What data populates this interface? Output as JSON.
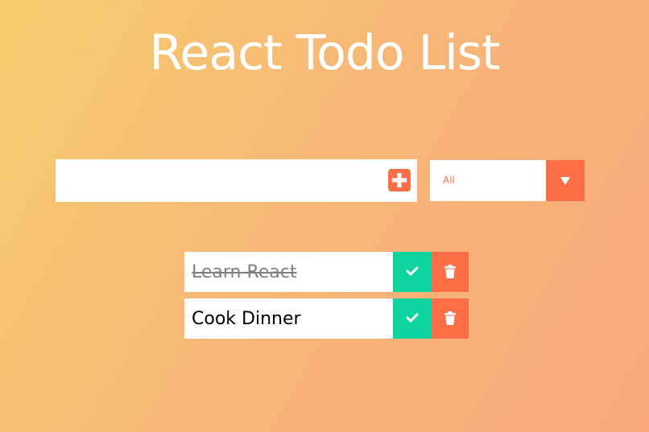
{
  "app": {
    "title": "React Todo List"
  },
  "input": {
    "value": "",
    "placeholder": "",
    "add_icon": "plus-square-icon"
  },
  "filter": {
    "selected": "All",
    "arrow_icon": "caret-down-icon"
  },
  "todos": [
    {
      "text": "Learn React",
      "completed": true
    },
    {
      "text": "Cook Dinner",
      "completed": false
    }
  ],
  "colors": {
    "accent": "#ff6f47",
    "complete": "#0ed4a0",
    "text_completed": "#808080",
    "background_start": "#f6cd6d",
    "background_end": "#f9a97b"
  },
  "icons": {
    "complete": "check-icon",
    "delete": "trash-icon"
  }
}
